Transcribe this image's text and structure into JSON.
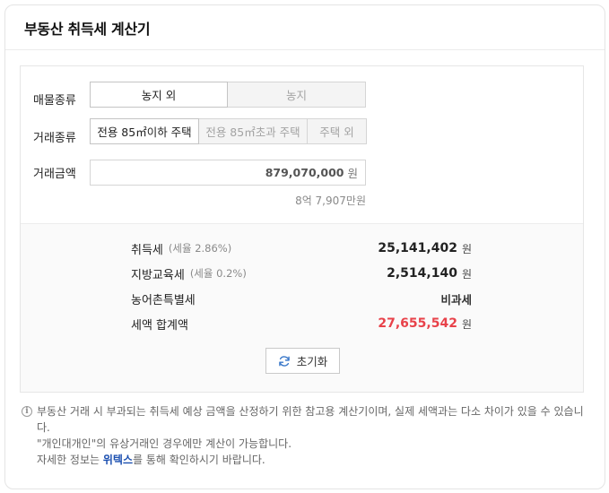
{
  "header": {
    "title": "부동산 취득세 계산기"
  },
  "property_type": {
    "label": "매물종류",
    "options": [
      "농지 외",
      "농지"
    ],
    "selected": "농지 외"
  },
  "transaction_type": {
    "label": "거래종류",
    "options": [
      "전용 85㎡이하 주택",
      "전용 85㎡초과 주택",
      "주택 외"
    ],
    "selected": "전용 85㎡이하 주택"
  },
  "amount": {
    "label": "거래금액",
    "value": "879,070,000",
    "unit": "원",
    "korean": "8억 7,907만원"
  },
  "results": {
    "acquisition_tax": {
      "label": "취득세",
      "rate": "(세율 2.86%)",
      "value": "25,141,402",
      "unit": "원"
    },
    "local_edu_tax": {
      "label": "지방교육세",
      "rate": "(세율 0.2%)",
      "value": "2,514,140",
      "unit": "원"
    },
    "rural_tax": {
      "label": "농어촌특별세",
      "value": "비과세"
    },
    "total": {
      "label": "세액 합계액",
      "value": "27,655,542",
      "unit": "원"
    }
  },
  "reset": {
    "label": "초기화",
    "icon": "refresh-icon"
  },
  "notes": {
    "info_icon": "i",
    "line1": "부동산 거래 시 부과되는 취득세 예상 금액을 산정하기 위한 참고용 계산기이며, 실제 세액과는 다소 차이가 있을 수 있습니다.",
    "line2": "\"개인대개인\"의 유상거래인 경우에만 계산이 가능합니다.",
    "line3_pre": "자세한 정보는 ",
    "line3_link": "위텍스",
    "line3_post": "를 통해 확인하시기 바랍니다."
  },
  "colors": {
    "total_red": "#e8424a",
    "link_blue": "#1b4fb0"
  }
}
